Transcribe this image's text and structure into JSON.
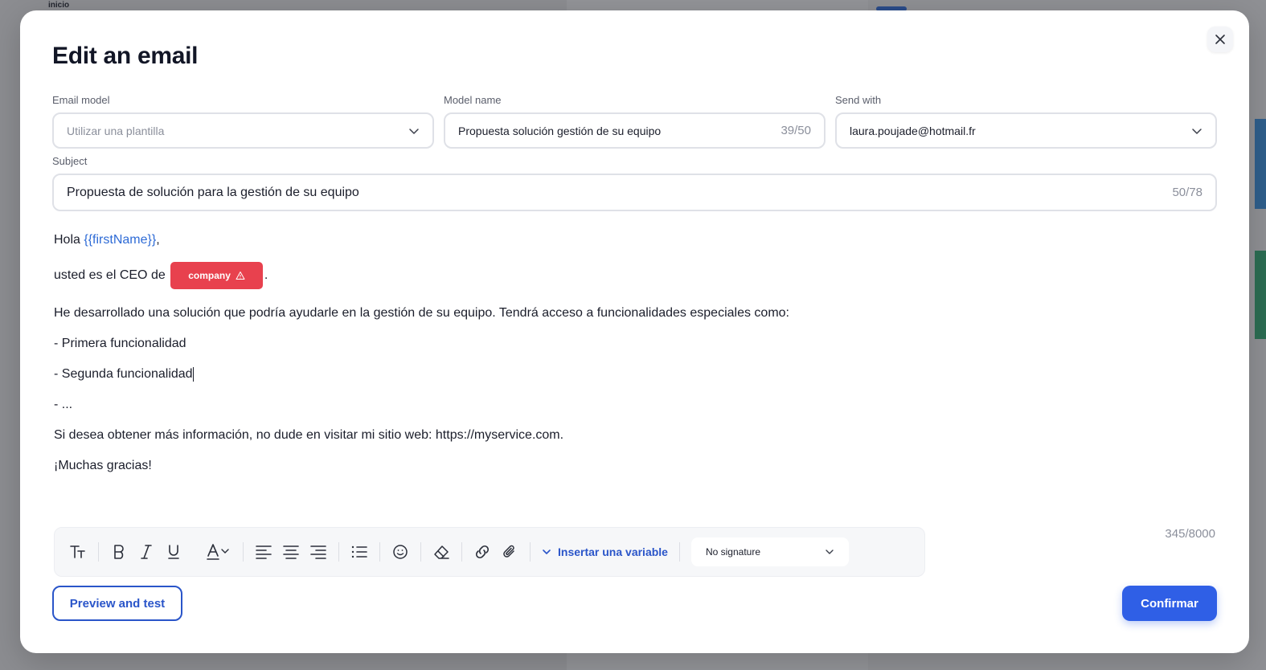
{
  "background": {
    "app_label": "inicio"
  },
  "modal": {
    "title": "Edit an email",
    "email_model": {
      "label": "Email model",
      "placeholder": "Utilizar una plantilla"
    },
    "model_name": {
      "label": "Model name",
      "value": "Propuesta solución gestión de su equipo",
      "counter": "39/50"
    },
    "send_with": {
      "label": "Send with",
      "value": "laura.poujade@hotmail.fr"
    },
    "subject": {
      "label": "Subject",
      "value": "Propuesta de solución para la gestión de su equipo",
      "counter": "50/78"
    },
    "body": {
      "greeting": "Hola",
      "greeting_variable": "{{firstName}}",
      "greeting_end": ",",
      "ceo_line": "usted es el CEO de",
      "company_chip": "company",
      "ceo_end": ".",
      "intro": "He desarrollado una solución que podría ayudarle en la gestión de su equipo. Tendrá acceso a funcionalidades especiales como:",
      "item1": "- Primera funcionalidad",
      "item2": "- Segunda funcionalidad",
      "item3": "- ...",
      "info": "Si desea obtener más información, no dude en visitar mi sitio web: https://myservice.com.",
      "thanks": "¡Muchas gracias!"
    },
    "char_count": "345/8000",
    "toolbar": {
      "insert_variable": "Insertar una variable",
      "signature": "No signature",
      "icons": [
        "text-size-icon",
        "bold-icon",
        "italic-icon",
        "underline-icon",
        "font-color-icon",
        "align-left-icon",
        "align-center-icon",
        "align-right-icon",
        "bullet-list-icon",
        "emoji-icon",
        "eraser-icon",
        "link-icon",
        "attachment-icon"
      ]
    },
    "buttons": {
      "preview": "Preview and test",
      "confirm": "Confirmar"
    },
    "colors": {
      "primary": "#2f5fe6",
      "variable": "#2e6bd6",
      "chip": "#e8414e"
    }
  }
}
